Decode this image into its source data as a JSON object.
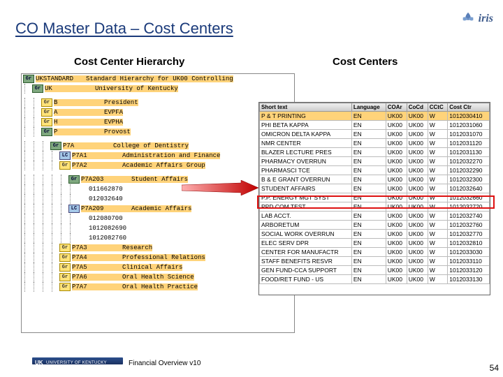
{
  "title": "CO Master Data – Cost Centers",
  "logo_text": "iris",
  "subtitle_left": "Cost Center Hierarchy",
  "subtitle_right": "Cost Centers",
  "hierarchy": [
    {
      "lvl": 0,
      "badge": "Gr",
      "bcls": "b-gr",
      "code": "UKSTANDARD",
      "desc": "Standard Hierarchy for UK00 Controlling",
      "hl": true
    },
    {
      "lvl": 1,
      "badge": "Gr",
      "bcls": "b-gr",
      "code": "UK",
      "desc": "University of Kentucky",
      "hl": true
    },
    {
      "lvl": 2,
      "badge": "Gr",
      "bcls": "b-ye",
      "code": "B",
      "desc": "President",
      "hl": true
    },
    {
      "lvl": 2,
      "badge": "Gr",
      "bcls": "b-ye",
      "code": "A",
      "desc": "EVPFA",
      "hl": true
    },
    {
      "lvl": 2,
      "badge": "Gr",
      "bcls": "b-ye",
      "code": "H",
      "desc": "EVPHA",
      "hl": true
    },
    {
      "lvl": 2,
      "badge": "Gr",
      "bcls": "b-gr",
      "code": "P",
      "desc": "Provost",
      "hl": true
    },
    {
      "lvl": 3,
      "badge": "Gr",
      "bcls": "b-gr",
      "code": "P7A",
      "desc": "College of Dentistry",
      "hl": true
    },
    {
      "lvl": 4,
      "badge": "LC",
      "bcls": "b-lc",
      "code": "P7A1",
      "desc": "Administration and Finance",
      "hl": true
    },
    {
      "lvl": 4,
      "badge": "Gr",
      "bcls": "b-ye",
      "code": "P7A2",
      "desc": "Academic Affairs Group",
      "hl": true
    },
    {
      "lvl": 5,
      "badge": "Gr",
      "bcls": "b-gr",
      "code": "P7A203",
      "desc": "Student Affairs",
      "hl": true
    },
    {
      "lvl": 6,
      "badge": "",
      "bcls": "",
      "code": "011662870",
      "desc": ""
    },
    {
      "lvl": 6,
      "badge": "",
      "bcls": "",
      "code": "012032640",
      "desc": ""
    },
    {
      "lvl": 5,
      "badge": "LC",
      "bcls": "b-lc",
      "code": "P7A209",
      "desc": "Academic Affairs",
      "hl": true
    },
    {
      "lvl": 6,
      "badge": "",
      "bcls": "",
      "code": "012080700",
      "desc": ""
    },
    {
      "lvl": 6,
      "badge": "",
      "bcls": "",
      "code": "1012082690",
      "desc": ""
    },
    {
      "lvl": 6,
      "badge": "",
      "bcls": "",
      "code": "1012082760",
      "desc": ""
    },
    {
      "lvl": 4,
      "badge": "Gr",
      "bcls": "b-ye",
      "code": "P7A3",
      "desc": "Research",
      "hl": true
    },
    {
      "lvl": 4,
      "badge": "Gr",
      "bcls": "b-ye",
      "code": "P7A4",
      "desc": "Professional Relations",
      "hl": true
    },
    {
      "lvl": 4,
      "badge": "Gr",
      "bcls": "b-ye",
      "code": "P7A5",
      "desc": "Clinical Affairs",
      "hl": true
    },
    {
      "lvl": 4,
      "badge": "Gr",
      "bcls": "b-ye",
      "code": "P7A6",
      "desc": "Oral Health Science",
      "hl": true
    },
    {
      "lvl": 4,
      "badge": "Gr",
      "bcls": "b-ye",
      "code": "P7A7",
      "desc": "Oral Health Practice",
      "hl": true
    }
  ],
  "cc_headers": [
    "Short text",
    "Language",
    "COAr",
    "CoCd",
    "CCtC",
    "Cost Ctr"
  ],
  "cc_rows": [
    {
      "t": "P & T PRINTING",
      "l": "EN",
      "a": "UK00",
      "c": "UK00",
      "g": "W",
      "n": "1012030410",
      "hl": true
    },
    {
      "t": "PHI BETA KAPPA",
      "l": "EN",
      "a": "UK00",
      "c": "UK00",
      "g": "W",
      "n": "1012031060"
    },
    {
      "t": "OMICRON DELTA KAPPA",
      "l": "EN",
      "a": "UK00",
      "c": "UK00",
      "g": "W",
      "n": "1012031070"
    },
    {
      "t": "NMR CENTER",
      "l": "EN",
      "a": "UK00",
      "c": "UK00",
      "g": "W",
      "n": "1012031120"
    },
    {
      "t": "BLAZER LECTURE PRES",
      "l": "EN",
      "a": "UK00",
      "c": "UK00",
      "g": "W",
      "n": "1012031130"
    },
    {
      "t": "PHARMACY OVERRUN",
      "l": "EN",
      "a": "UK00",
      "c": "UK00",
      "g": "W",
      "n": "1012032270"
    },
    {
      "t": "PHARMASCI TCE",
      "l": "EN",
      "a": "UK00",
      "c": "UK00",
      "g": "W",
      "n": "1012032290"
    },
    {
      "t": "B & E GRANT OVERRUN",
      "l": "EN",
      "a": "UK00",
      "c": "UK00",
      "g": "W",
      "n": "1012032300"
    },
    {
      "t": "STUDENT AFFAIRS",
      "l": "EN",
      "a": "UK00",
      "c": "UK00",
      "g": "W",
      "n": "1012032640",
      "red": true
    },
    {
      "t": "P.P. ENERGY MGT SYST",
      "l": "EN",
      "a": "UK00",
      "c": "UK00",
      "g": "W",
      "n": "1012032660"
    },
    {
      "t": "PPD COM TEST",
      "l": "EN",
      "a": "UK00",
      "c": "UK00",
      "g": "W",
      "n": "1012032720"
    },
    {
      "t": "LAB ACCT.",
      "l": "EN",
      "a": "UK00",
      "c": "UK00",
      "g": "W",
      "n": "1012032740"
    },
    {
      "t": "ARBORETUM",
      "l": "EN",
      "a": "UK00",
      "c": "UK00",
      "g": "W",
      "n": "1012032760"
    },
    {
      "t": "SOCIAL WORK OVERRUN",
      "l": "EN",
      "a": "UK00",
      "c": "UK00",
      "g": "W",
      "n": "1012032770"
    },
    {
      "t": "ELEC SERV DPR",
      "l": "EN",
      "a": "UK00",
      "c": "UK00",
      "g": "W",
      "n": "1012032810"
    },
    {
      "t": "CENTER FOR MANUFACTR",
      "l": "EN",
      "a": "UK00",
      "c": "UK00",
      "g": "W",
      "n": "1012033030"
    },
    {
      "t": "STAFF BENEFITS RESVR",
      "l": "EN",
      "a": "UK00",
      "c": "UK00",
      "g": "W",
      "n": "1012033110"
    },
    {
      "t": "GEN FUND-CCA SUPPORT",
      "l": "EN",
      "a": "UK00",
      "c": "UK00",
      "g": "W",
      "n": "1012033120"
    },
    {
      "t": "FOOD/RET FUND - US",
      "l": "EN",
      "a": "UK00",
      "c": "UK00",
      "g": "W",
      "n": "1012033130"
    }
  ],
  "footer_uk": "UK",
  "footer_uky": "UNIVERSITY OF KENTUCKY",
  "footer_text": "Financial Overview v10",
  "page_number": "54"
}
